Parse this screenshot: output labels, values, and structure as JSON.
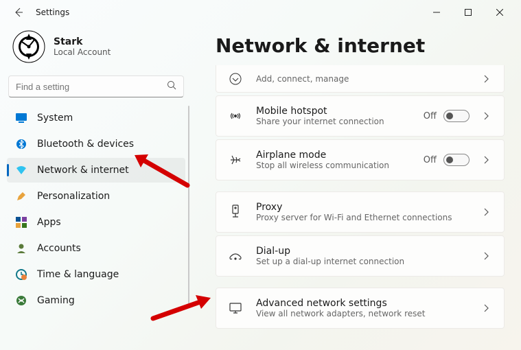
{
  "window": {
    "title": "Settings",
    "page_title": "Network & internet"
  },
  "profile": {
    "name": "Stark",
    "type": "Local Account"
  },
  "search": {
    "placeholder": "Find a setting"
  },
  "nav": {
    "items": [
      {
        "label": "System",
        "icon": "system"
      },
      {
        "label": "Bluetooth & devices",
        "icon": "bluetooth"
      },
      {
        "label": "Network & internet",
        "icon": "wifi",
        "selected": true
      },
      {
        "label": "Personalization",
        "icon": "personalize"
      },
      {
        "label": "Apps",
        "icon": "apps"
      },
      {
        "label": "Accounts",
        "icon": "accounts"
      },
      {
        "label": "Time & language",
        "icon": "time"
      },
      {
        "label": "Gaming",
        "icon": "gaming"
      }
    ]
  },
  "cards": {
    "partial": {
      "sub": "Add, connect, manage"
    },
    "hotspot": {
      "title": "Mobile hotspot",
      "sub": "Share your internet connection",
      "toggle": "Off"
    },
    "airplane": {
      "title": "Airplane mode",
      "sub": "Stop all wireless communication",
      "toggle": "Off"
    },
    "proxy": {
      "title": "Proxy",
      "sub": "Proxy server for Wi-Fi and Ethernet connections"
    },
    "dialup": {
      "title": "Dial-up",
      "sub": "Set up a dial-up internet connection"
    },
    "advanced": {
      "title": "Advanced network settings",
      "sub": "View all network adapters, network reset"
    }
  }
}
